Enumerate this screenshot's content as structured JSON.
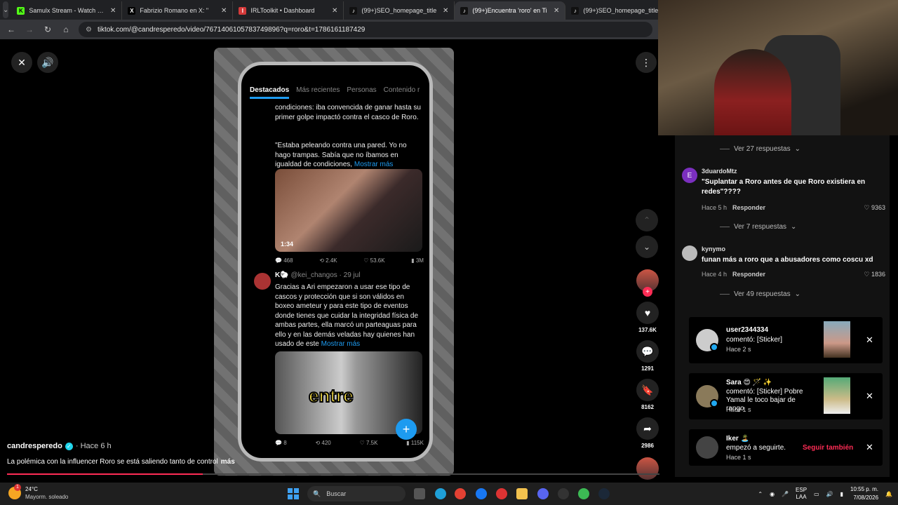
{
  "browser": {
    "tabs": [
      {
        "title": "Samulx Stream - Watch Live on",
        "fav_color": "#53fc18",
        "fav_glyph": "K",
        "active": false
      },
      {
        "title": "Fabrizio Romano en X: \"",
        "fav_color": "#000000",
        "fav_glyph": "X",
        "active": false
      },
      {
        "title": "IRLToolkit • Dashboard",
        "fav_color": "#d43a3a",
        "fav_glyph": "I",
        "active": false
      },
      {
        "title": "(99+)SEO_homepage_title",
        "fav_color": "#111111",
        "fav_glyph": "♪",
        "active": false
      },
      {
        "title": "(99+)Encuentra 'roro' en Ti",
        "fav_color": "#111111",
        "fav_glyph": "♪",
        "active": true
      },
      {
        "title": "(99+)SEO_homepage_title",
        "fav_color": "#111111",
        "fav_glyph": "♪",
        "active": false
      }
    ],
    "url": "tiktok.com/@candresperedo/video/7671406105783749896?q=roro&t=1786161187429"
  },
  "video": {
    "phone_tabs": [
      "Destacados",
      "Más recientes",
      "Personas",
      "Contenido r"
    ],
    "tweet1_text": "condiciones: iba convencida de ganar hasta su primer golpe impactó contra el casco de Roro.",
    "tweet1_quote": "\"Estaba peleando contra una pared. Yo no hago trampas. Sabía que no íbamos en igualdad de condiciones,",
    "more_label": "Mostrar más",
    "video_duration": "1:34",
    "tweet1_stats": [
      "468",
      "2.4K",
      "53.6K",
      "3M"
    ],
    "tweet2_author": "K🐑",
    "tweet2_handle": "@kei_changos · 29 jul",
    "tweet2_text": "Gracias a Ari empezaron a usar ese tipo de cascos y protección que si son válidos en boxeo ameteur y para este tipo de eventos donde tienes que cuidar la integridad física de ambas partes, ella marcó un parteaguas para ello y en las demás veladas hay quienes han usado de este",
    "tweet2_stats": [
      "8",
      "420",
      "7.5K",
      "115K"
    ],
    "overlay_caption": "entre",
    "author": "candresperedo",
    "posted": "· Hace 6 h",
    "description": "La polémica con la influencer Roro se está saliendo tanto de control",
    "description_more": "más",
    "progress": 0.3
  },
  "actions": {
    "likes": "137.6K",
    "comments": "1291",
    "saves": "8162",
    "shares": "2986"
  },
  "comments": {
    "items": [
      {
        "replies": "Ver 27 respuestas"
      },
      {
        "initial": "E",
        "color": "#7b2fbf",
        "user": "3duardoMtz",
        "text": "\"Suplantar a Roro antes de que Roro existiera en redes\"????",
        "time": "Hace 5 h",
        "reply": "Responder",
        "likes": "9363",
        "replies": "Ver 7 respuestas"
      },
      {
        "initial": "",
        "color": "#bbbbbb",
        "user": "kynymo",
        "text": "funan más a roro que a abusadores como coscu xd",
        "time": "Hace 4 h",
        "reply": "Responder",
        "likes": "1836",
        "replies": "Ver 49 respuestas"
      }
    ]
  },
  "notifications": [
    {
      "user": "user2344334",
      "message": "comentó: [Sticker]",
      "time": "Hace 2 s"
    },
    {
      "user": "Sara 😍 🪄 ✨",
      "message": "comentó: [Sticker] Pobre Yamal le toco bajar de rango",
      "time": "Hace 1 s"
    },
    {
      "user": "Iker 🏝️",
      "message": "empezó a seguirte.",
      "time": "Hace 1 s",
      "follow_label": "Seguir también"
    }
  ],
  "taskbar": {
    "temp": "24°C",
    "weather": "Mayorm. soleado",
    "weather_badge": "1",
    "search_placeholder": "Buscar",
    "lang": "ESP",
    "lang2": "LAA",
    "time": "10:55 p. m.",
    "date": "7/08/2026"
  }
}
